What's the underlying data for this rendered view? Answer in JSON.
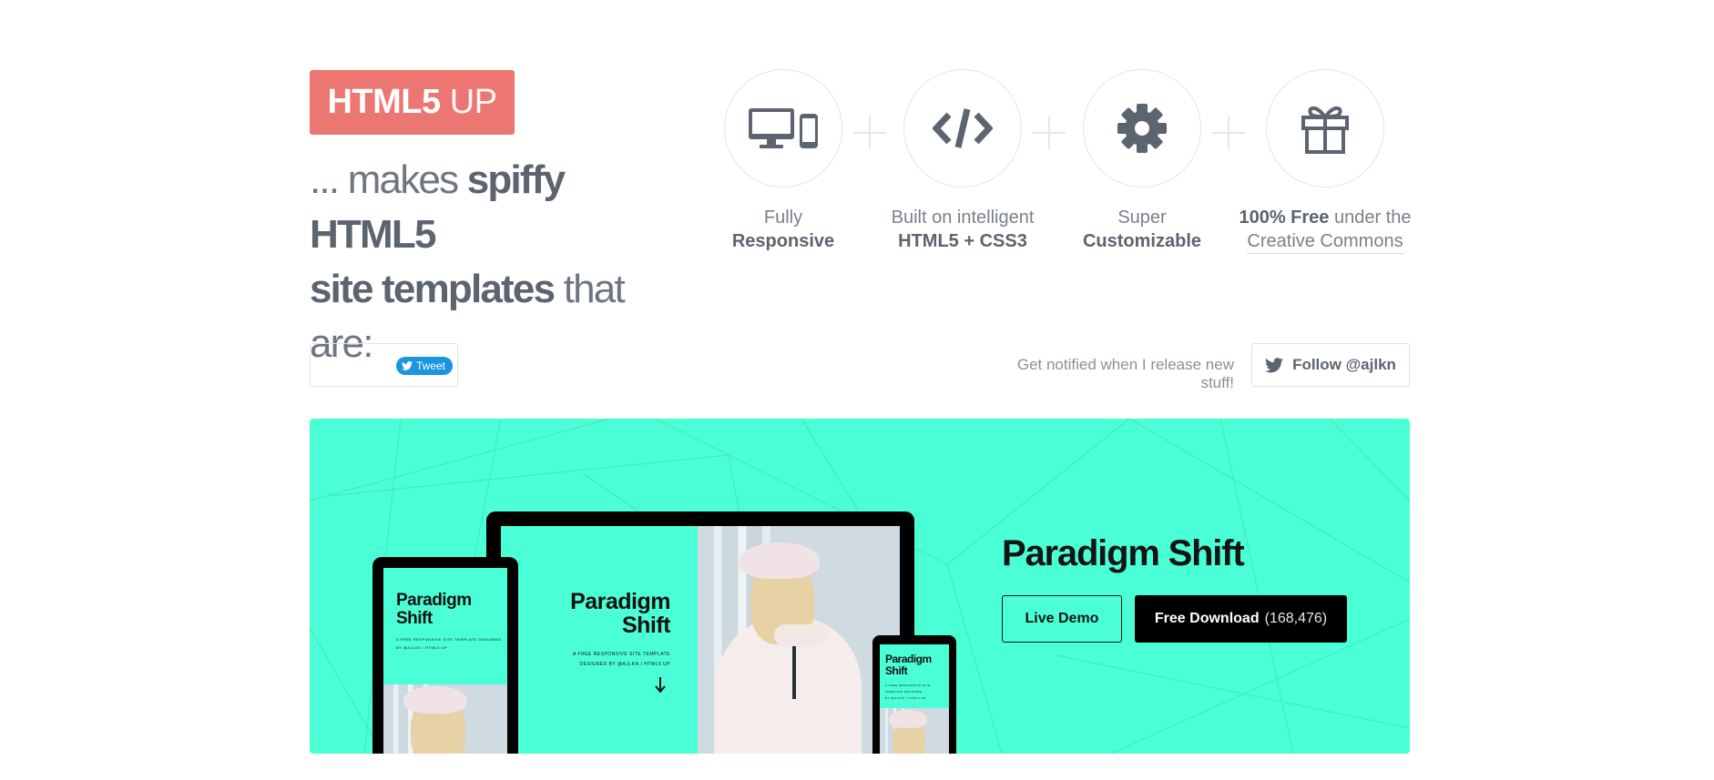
{
  "brand": {
    "bold": "HTML5",
    "light": " UP",
    "color": "#ec7672"
  },
  "tagline": {
    "pre": "... makes ",
    "bold1": "spiffy HTML5",
    "bold2": "site templates",
    "post": " that are:"
  },
  "features": [
    {
      "icon": "devices-icon",
      "line1": "Fully",
      "line2": "Responsive"
    },
    {
      "icon": "code-icon",
      "line1": "Built on intelligent",
      "line2": "HTML5 + CSS3"
    },
    {
      "icon": "gear-icon",
      "line1": "Super",
      "line2": "Customizable"
    },
    {
      "icon": "gift-icon",
      "line1_bold": "100% Free",
      "line1_rest": " under the",
      "line2": "Creative Commons"
    }
  ],
  "social": {
    "tweet_label": "Tweet",
    "notify_text": "Get notified when I release new stuff!",
    "follow_label": "Follow @ajlkn"
  },
  "featured": {
    "title": "Paradigm Shift",
    "live_demo": "Live Demo",
    "download": "Free Download",
    "download_count": "(168,476)",
    "accent": "#4affd6",
    "mockup_title_line1": "Paradigm",
    "mockup_title_line2": "Shift",
    "mockup_sub1": "A FREE RESPONSIVE SITE TEMPLATE",
    "mockup_sub2": "DESIGNED BY @AJLKN / HTML5 UP",
    "mockup_sub_short1": "A FREE RESPONSIVE SITE TEMPLATE DESIGNED",
    "mockup_sub_short2": "BY @AJLKN / HTML5 UP"
  }
}
